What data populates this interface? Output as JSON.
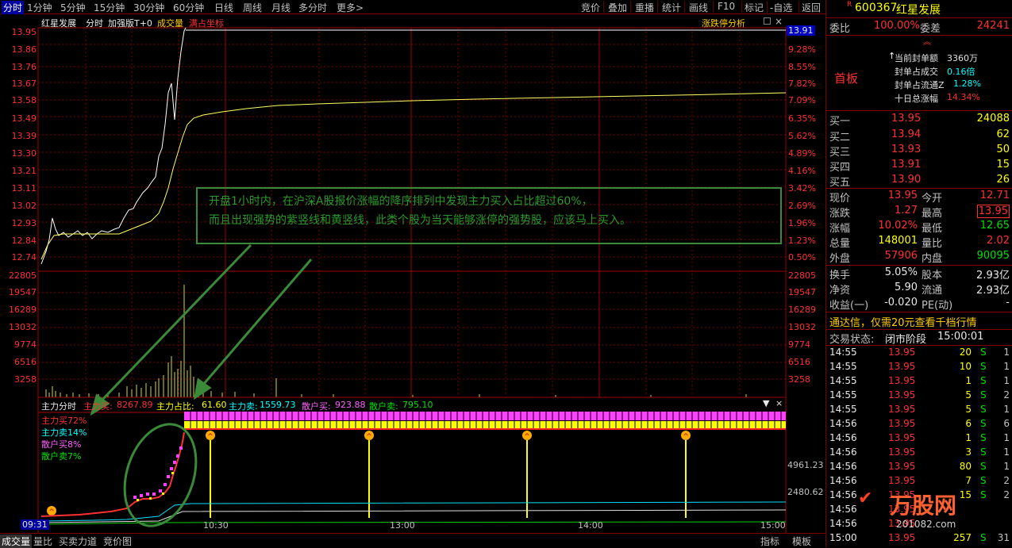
{
  "toolbar": {
    "tabs": [
      "分时",
      "1分钟",
      "5分钟",
      "15分钟",
      "30分钟",
      "60分钟",
      "日线",
      "周线",
      "月线",
      "多分时",
      "更多>"
    ],
    "right": [
      "竞价",
      "叠加",
      "重播",
      "统计",
      "画线",
      "F10",
      "标记",
      "-自选",
      "返回"
    ]
  },
  "chart_header": {
    "stock_name": "红星发展",
    "mode": "分时",
    "enhanced": "加强版T+0",
    "volume": "成交量",
    "fullcoord": "满占坐标",
    "limit_analysis": "涨跌停分析"
  },
  "price_axis": {
    "left": [
      "13.95",
      "13.86",
      "13.76",
      "13.67",
      "13.58",
      "13.49",
      "13.39",
      "13.30",
      "13.21",
      "13.11",
      "13.02",
      "12.93",
      "12.84",
      "12.74"
    ],
    "right": [
      "13.91",
      "9.28%",
      "8.55%",
      "7.82%",
      "7.09%",
      "6.35%",
      "5.62%",
      "4.89%",
      "4.16%",
      "3.42%",
      "2.69%",
      "1.96%",
      "1.23%",
      "0.50%"
    ]
  },
  "volume_axis": {
    "left": [
      "22805",
      "19547",
      "16289",
      "13032",
      "9774",
      "6516",
      "3258"
    ],
    "right": [
      "22805",
      "19547",
      "16289",
      "13032",
      "9774",
      "6516",
      "3258"
    ]
  },
  "annotation": {
    "line1": "开盘1小时内，在沪深A股报价涨幅的降序排列中发现主力买入占比超过60%，",
    "line2": "而且出现强势的紫竖线和黄竖线，此类个股为当天能够涨停的强势股，应该马上买入。"
  },
  "main_force": {
    "title": "主力分时",
    "buy_label": "主力买:",
    "buy_value": "8267.89",
    "ratio_label": "主力占比:",
    "ratio_value": "61.60",
    "sell_label": "主力卖:",
    "sell_value": "1559.73",
    "retail_buy_label": "散户买:",
    "retail_buy_value": "923.88",
    "retail_sell_label": "散户卖:",
    "retail_sell_value": "795.10",
    "legend": [
      "主力买72%",
      "主力卖14%",
      "散户买8%",
      "散户卖7%"
    ],
    "axis_right": [
      "4961.23",
      "2480.62"
    ]
  },
  "time_axis": [
    "09:31",
    "10:30",
    "13:00",
    "14:00",
    "15:00"
  ],
  "bottom_tabs": [
    "成交量",
    "量比",
    "买卖力道",
    "竞价图"
  ],
  "bottom_right": [
    "指标",
    "模板"
  ],
  "quote": {
    "code": "600367",
    "name": "红星发展",
    "webi_label": "委比",
    "webi_value": "100.00%",
    "weicha_label": "委差",
    "weicha_value": "24241",
    "board": "首板",
    "seal_amount_label": "当前封单额",
    "seal_amount": "3360万",
    "seal_ratio_label": "封单占成交",
    "seal_ratio": "0.16倍",
    "seal_float_label": "封单占流通Z",
    "seal_float": "1.28%",
    "tenday_label": "十日总涨幅",
    "tenday": "14.34%",
    "bids": [
      {
        "label": "买一",
        "price": "13.95",
        "vol": "24088"
      },
      {
        "label": "买二",
        "price": "13.94",
        "vol": "62"
      },
      {
        "label": "买三",
        "price": "13.93",
        "vol": "50"
      },
      {
        "label": "买四",
        "price": "13.91",
        "vol": "15"
      },
      {
        "label": "买五",
        "price": "13.90",
        "vol": "26"
      }
    ],
    "stats": [
      {
        "l1": "现价",
        "v1": "13.95",
        "l2": "今开",
        "v2": "12.71"
      },
      {
        "l1": "涨跌",
        "v1": "1.27",
        "l2": "最高",
        "v2": "13.95"
      },
      {
        "l1": "涨幅",
        "v1": "10.02%",
        "l2": "最低",
        "v2": "12.65"
      },
      {
        "l1": "总量",
        "v1": "148001",
        "l2": "量比",
        "v2": "2.02"
      },
      {
        "l1": "外盘",
        "v1": "57906",
        "l2": "内盘",
        "v2": "90095"
      },
      {
        "l1": "换手",
        "v1": "5.05%",
        "l2": "股本",
        "v2": "2.93亿"
      },
      {
        "l1": "净资",
        "v1": "5.90",
        "l2": "流通",
        "v2": "2.93亿"
      },
      {
        "l1": "收益(一)",
        "v1": "-0.020",
        "l2": "PE(动)",
        "v2": "-"
      }
    ],
    "promo": "通达信，仅需20元查看千档行情",
    "status_label": "交易状态:",
    "status_value": "闭市阶段",
    "status_time": "15:00:01",
    "ticks": [
      {
        "t": "14:55",
        "p": "13.95",
        "v": "20",
        "d": "S",
        "n": "1"
      },
      {
        "t": "14:55",
        "p": "13.95",
        "v": "10",
        "d": "S",
        "n": "1"
      },
      {
        "t": "14:55",
        "p": "13.95",
        "v": "1",
        "d": "S",
        "n": "1"
      },
      {
        "t": "14:55",
        "p": "13.95",
        "v": "5",
        "d": "S",
        "n": "2"
      },
      {
        "t": "14:55",
        "p": "13.95",
        "v": "5",
        "d": "S",
        "n": "1"
      },
      {
        "t": "14:56",
        "p": "13.95",
        "v": "6",
        "d": "S",
        "n": "6"
      },
      {
        "t": "14:56",
        "p": "13.95",
        "v": "1",
        "d": "S",
        "n": "1"
      },
      {
        "t": "14:56",
        "p": "13.95",
        "v": "3",
        "d": "S",
        "n": "1"
      },
      {
        "t": "14:56",
        "p": "13.95",
        "v": "80",
        "d": "S",
        "n": "1"
      },
      {
        "t": "14:56",
        "p": "13.95",
        "v": "7",
        "d": "S",
        "n": "2"
      },
      {
        "t": "14:56",
        "p": "13.95",
        "v": "15",
        "d": "S",
        "n": "2"
      },
      {
        "t": "14:56",
        "p": "13.95",
        "v": "",
        "d": "",
        "n": ""
      },
      {
        "t": "14:56",
        "p": "13.95",
        "v": "",
        "d": "",
        "n": ""
      },
      {
        "t": "15:00",
        "p": "13.95",
        "v": "257",
        "d": "S",
        "n": "31"
      }
    ],
    "watermark": "万股网",
    "watermark_url": "201082.com"
  }
}
